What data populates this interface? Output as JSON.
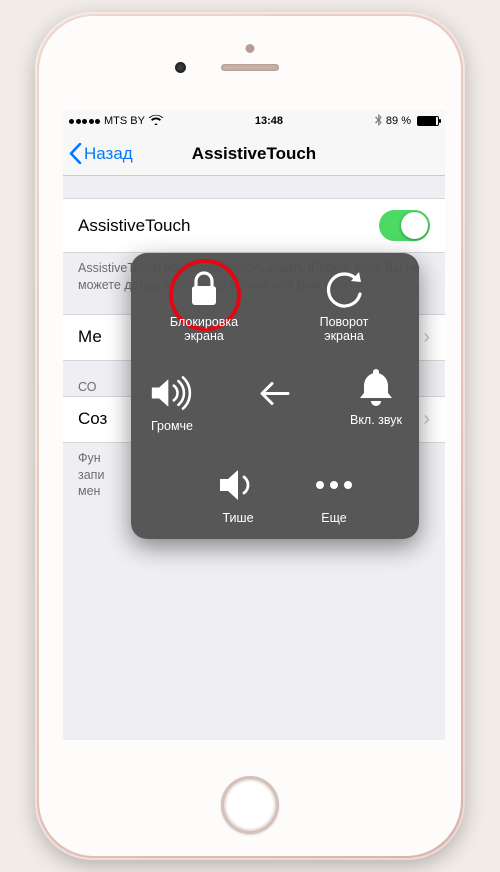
{
  "statusbar": {
    "carrier": "MTS BY",
    "time": "13:48",
    "battery_pct": "89 %"
  },
  "nav": {
    "back": "Назад",
    "title": "AssistiveTouch"
  },
  "rows": {
    "main_toggle": "AssistiveTouch",
    "desc": "AssistiveTouch позволяет использовать iPhone, если Вы не можете дотрагиваться до экрана или Вам необ",
    "menu": "Ме",
    "section_header": "СО",
    "create": "Соз",
    "footer2": "Фун\nзапи\nмен"
  },
  "at": {
    "lock": "Блокировка\nэкрана",
    "rotate": "Поворот\nэкрана",
    "louder": "Громче",
    "sound_on": "Вкл. звук",
    "quieter": "Тише",
    "more": "Еще"
  }
}
